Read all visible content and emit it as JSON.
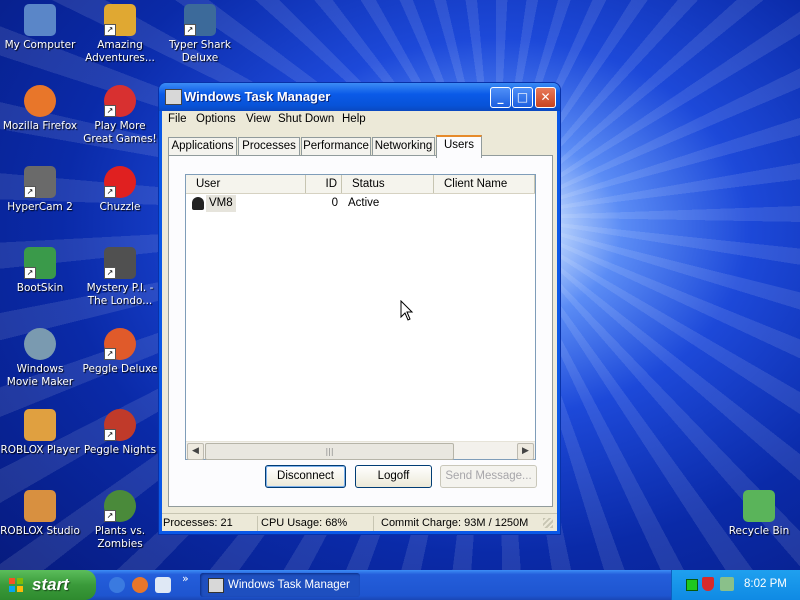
{
  "desktop": {
    "icons": [
      {
        "label": "My Computer",
        "icon": "computer-icon",
        "color": "#5a86c8"
      },
      {
        "label": "Amazing Adventures...",
        "icon": "game-icon",
        "color": "#e0a832"
      },
      {
        "label": "Typer Shark Deluxe",
        "icon": "shark-icon",
        "color": "#3c6a9a"
      },
      {
        "label": "Mozilla Firefox",
        "icon": "firefox-icon",
        "color": "#e8762a"
      },
      {
        "label": "Play More Great Games!",
        "icon": "popcap-icon",
        "color": "#d83030"
      },
      {
        "label": "HyperCam 2",
        "icon": "camera-icon",
        "color": "#6a6a6a"
      },
      {
        "label": "Chuzzle",
        "icon": "chuzzle-icon",
        "color": "#e02020"
      },
      {
        "label": "BootSkin",
        "icon": "bootskin-icon",
        "color": "#3a9a4a"
      },
      {
        "label": "Mystery P.I. - The Londo...",
        "icon": "mystery-icon",
        "color": "#505050"
      },
      {
        "label": "Windows Movie Maker",
        "icon": "film-icon",
        "color": "#7a9ab0"
      },
      {
        "label": "Peggle Deluxe",
        "icon": "peggle-icon",
        "color": "#e05a2a"
      },
      {
        "label": "ROBLOX Player",
        "icon": "roblox-icon",
        "color": "#e0a040"
      },
      {
        "label": "Peggle Nights",
        "icon": "peggle-nights-icon",
        "color": "#c03a2a"
      },
      {
        "label": "ROBLOX Studio",
        "icon": "roblox-studio-icon",
        "color": "#d89040"
      },
      {
        "label": "Plants vs. Zombies",
        "icon": "plant-icon",
        "color": "#4a8a3a"
      },
      {
        "label": "Recycle Bin",
        "icon": "recycle-bin-icon",
        "color": "#5ab45a"
      }
    ]
  },
  "window": {
    "title": "Windows Task Manager",
    "controls": {
      "minimize": "_",
      "maximize": "□",
      "close": "✕"
    },
    "menu": [
      "File",
      "Options",
      "View",
      "Shut Down",
      "Help"
    ],
    "tabs": [
      "Applications",
      "Processes",
      "Performance",
      "Networking",
      "Users"
    ],
    "active_tab": "Users",
    "columns": [
      "User",
      "ID",
      "Status",
      "Client Name"
    ],
    "rows": [
      {
        "user": "VM8",
        "id": "0",
        "status": "Active",
        "client": ""
      }
    ],
    "buttons": {
      "disconnect": "Disconnect",
      "logoff": "Logoff",
      "send_message": "Send Message..."
    },
    "status": {
      "processes": "Processes: 21",
      "cpu": "CPU Usage: 68%",
      "commit": "Commit Charge: 93M / 1250M"
    }
  },
  "taskbar": {
    "start_label": "start",
    "task_button": "Windows Task Manager",
    "overflow": "»",
    "clock": "8:02 PM"
  },
  "colors": {
    "titlebar": "#0a5ae8",
    "start": "#3a9a3a",
    "tray": "#0f8ae4",
    "active_tab_accent": "#e68b2c"
  }
}
